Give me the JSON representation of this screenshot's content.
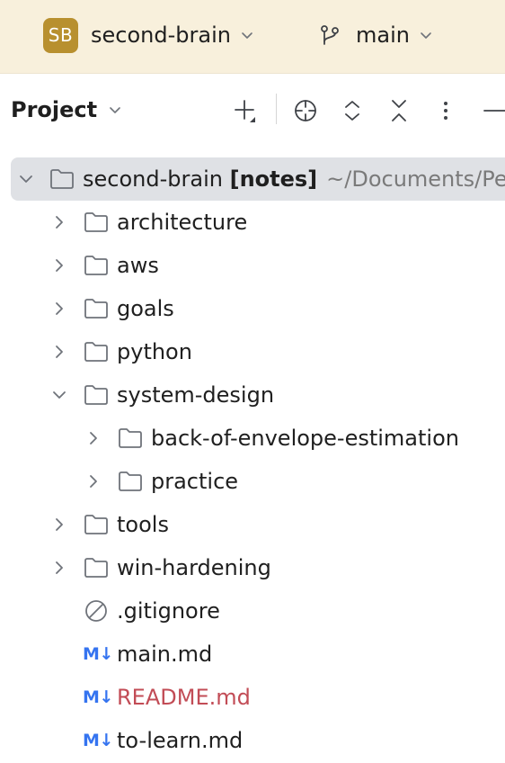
{
  "header": {
    "project_initials": "SB",
    "project_name": "second-brain",
    "branch_name": "main"
  },
  "tool_window": {
    "title": "Project",
    "buttons": [
      "new-element",
      "locate-file",
      "expand-all",
      "collapse-all",
      "options",
      "hide"
    ]
  },
  "tree": {
    "root": {
      "name": "second-brain",
      "qualifier": "[notes]",
      "path": "~/Documents/Pe"
    },
    "items": [
      {
        "label": "architecture",
        "type": "folder",
        "expanded": false
      },
      {
        "label": "aws",
        "type": "folder",
        "expanded": false
      },
      {
        "label": "goals",
        "type": "folder",
        "expanded": false
      },
      {
        "label": "python",
        "type": "folder",
        "expanded": false
      },
      {
        "label": "system-design",
        "type": "folder",
        "expanded": true
      },
      {
        "label": "back-of-envelope-estimation",
        "type": "folder",
        "expanded": false
      },
      {
        "label": "practice",
        "type": "folder",
        "expanded": false
      },
      {
        "label": "tools",
        "type": "folder",
        "expanded": false
      },
      {
        "label": "win-hardening",
        "type": "folder",
        "expanded": false
      },
      {
        "label": ".gitignore",
        "type": "ignore-file"
      },
      {
        "label": "main.md",
        "type": "markdown",
        "md_badge": "M↓"
      },
      {
        "label": "README.md",
        "type": "markdown",
        "md_badge": "M↓",
        "status": "modified"
      },
      {
        "label": "to-learn.md",
        "type": "markdown",
        "md_badge": "M↓"
      }
    ]
  },
  "colors": {
    "header_bg": "#f8f0dc",
    "avatar_bg": "#b8902f",
    "selection_bg": "#dfe1e5",
    "markdown_badge": "#3574f0",
    "modified_text": "#c24c56",
    "path_text": "#7a7a7a"
  }
}
